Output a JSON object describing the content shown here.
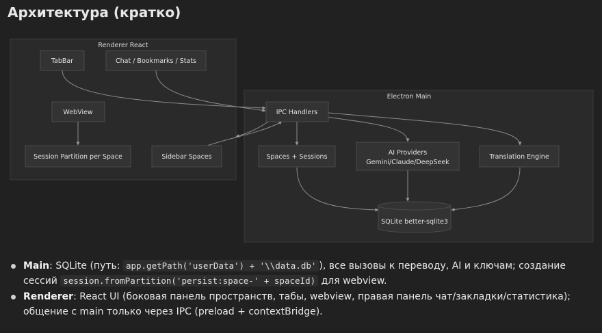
{
  "title": "Архитектура (кратко)",
  "diagram": {
    "clusters": {
      "renderer": "Renderer React",
      "main": "Electron Main"
    },
    "nodes": {
      "tabbar": "TabBar",
      "chat": "Chat / Bookmarks / Stats",
      "webview": "WebView",
      "session": "Session Partition per Space",
      "sidebar": "Sidebar Spaces",
      "ipc": "IPC Handlers",
      "spaces": "Spaces + Sessions",
      "ai_line1": "AI Providers",
      "ai_line2": "Gemini/Claude/DeepSeek",
      "translation": "Translation Engine",
      "sqlite": "SQLite better-sqlite3"
    }
  },
  "bullets": [
    {
      "label": "Main",
      "text1": ": SQLite (путь: ",
      "code1": "app.getPath('userData') + '\\\\data.db'",
      "text2": "), все вызовы к переводу, AI и ключам; создание сессий ",
      "code2": "session.fromPartition('persist:space-' + spaceId)",
      "text3": " для webview."
    },
    {
      "label": "Renderer",
      "text1": ": React UI (боковая панель пространств, табы, webview, правая панель чат/закладки/статистика); общение с main только через IPC (preload + contextBridge)."
    }
  ]
}
